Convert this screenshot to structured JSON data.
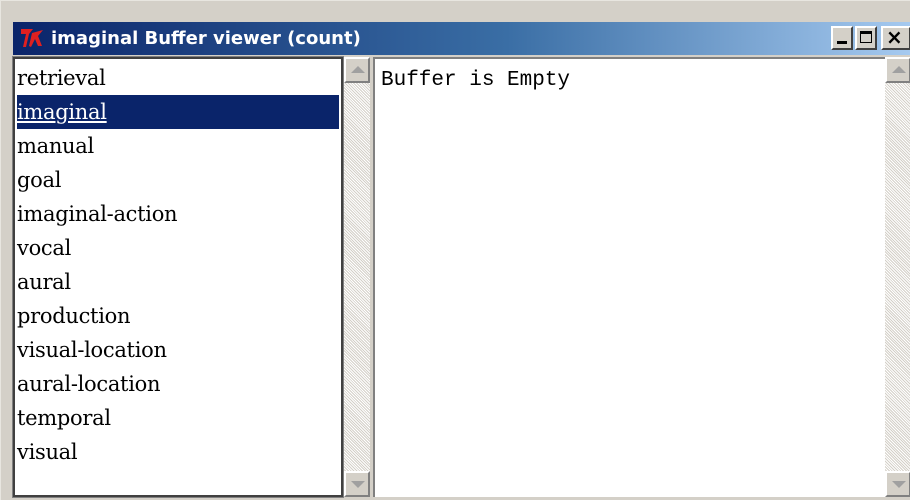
{
  "window": {
    "title": "imaginal Buffer viewer (count)",
    "icon": "tk-feather-icon"
  },
  "buffer_list": {
    "items": [
      {
        "label": "retrieval"
      },
      {
        "label": "imaginal"
      },
      {
        "label": "manual"
      },
      {
        "label": "goal"
      },
      {
        "label": "imaginal-action"
      },
      {
        "label": "vocal"
      },
      {
        "label": "aural"
      },
      {
        "label": "production"
      },
      {
        "label": "visual-location"
      },
      {
        "label": "aural-location"
      },
      {
        "label": "temporal"
      },
      {
        "label": "visual"
      }
    ],
    "selected": "imaginal"
  },
  "buffer_content": {
    "text": "Buffer is Empty"
  },
  "colors": {
    "selection": "#0a246a",
    "titlebar_start": "#0a246a",
    "titlebar_end": "#a6caf0",
    "tk_icon": "#e02020"
  }
}
